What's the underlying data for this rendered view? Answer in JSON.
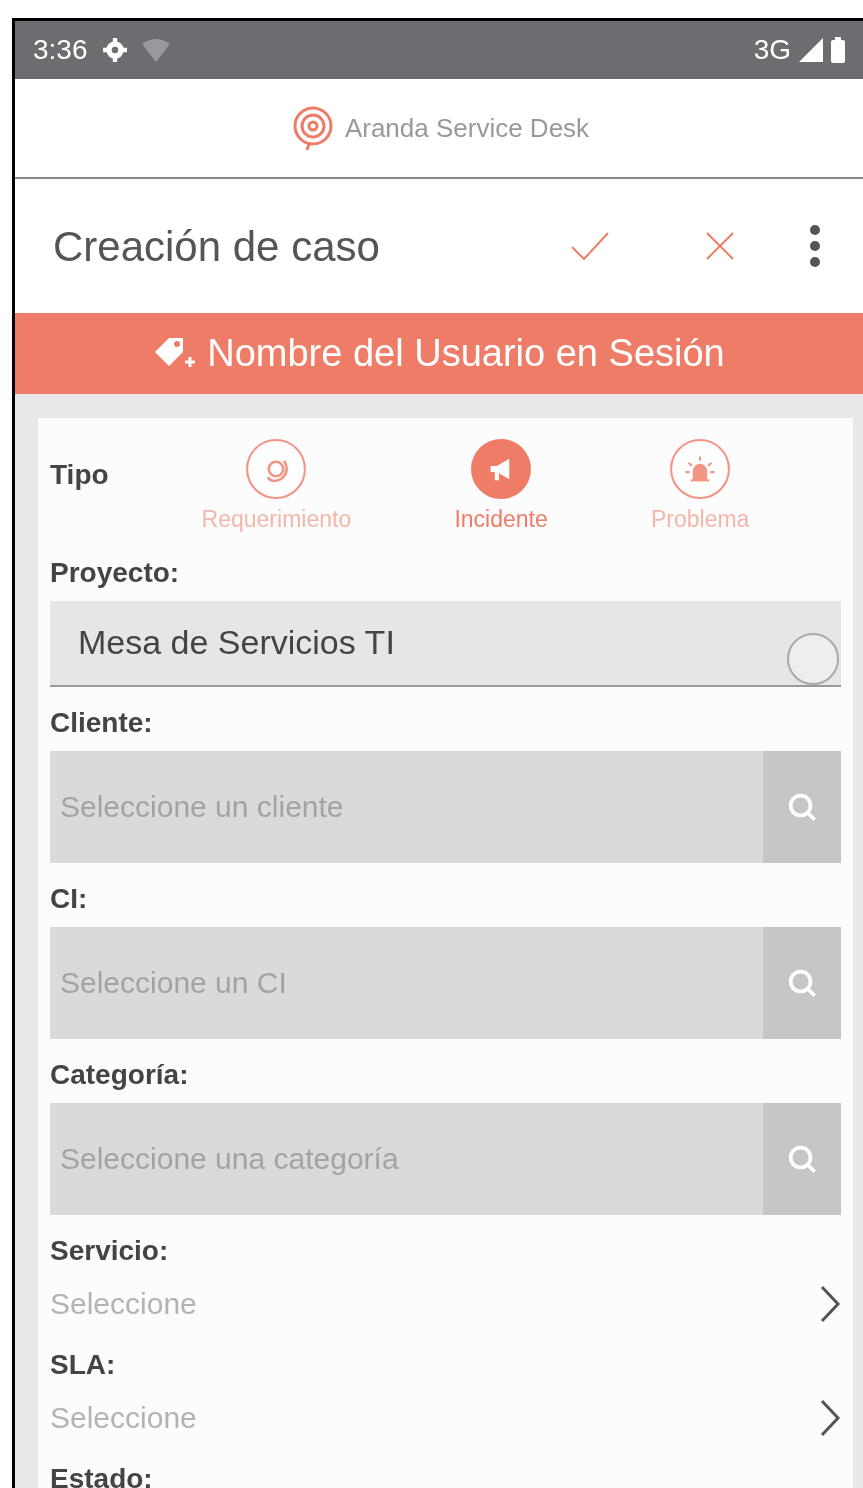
{
  "status_bar": {
    "time": "3:36",
    "network": "3G"
  },
  "header": {
    "app_name": "Aranda Service Desk"
  },
  "toolbar": {
    "title": "Creación de caso"
  },
  "banner": {
    "text": "Nombre del Usuario en Sesión"
  },
  "form": {
    "type_label": "Tipo",
    "types": [
      {
        "kind": "request",
        "label": "Requerimiento",
        "selected": false
      },
      {
        "kind": "incident",
        "label": "Incidente",
        "selected": true
      },
      {
        "kind": "problem",
        "label": "Problema",
        "selected": false
      }
    ],
    "fields": [
      {
        "kind": "dropdown",
        "label": "Proyecto:",
        "value": "Mesa de Servicios TI"
      },
      {
        "kind": "search",
        "label": "Cliente:",
        "placeholder": "Seleccione un cliente"
      },
      {
        "kind": "search",
        "label": "CI:",
        "placeholder": "Seleccione un CI"
      },
      {
        "kind": "search",
        "label": "Categoría:",
        "placeholder": "Seleccione una categoría"
      },
      {
        "kind": "picker",
        "label": "Servicio:",
        "placeholder": "Seleccione"
      },
      {
        "kind": "picker",
        "label": "SLA:",
        "placeholder": "Seleccione"
      },
      {
        "kind": "label_only",
        "label": "Estado:"
      }
    ]
  }
}
